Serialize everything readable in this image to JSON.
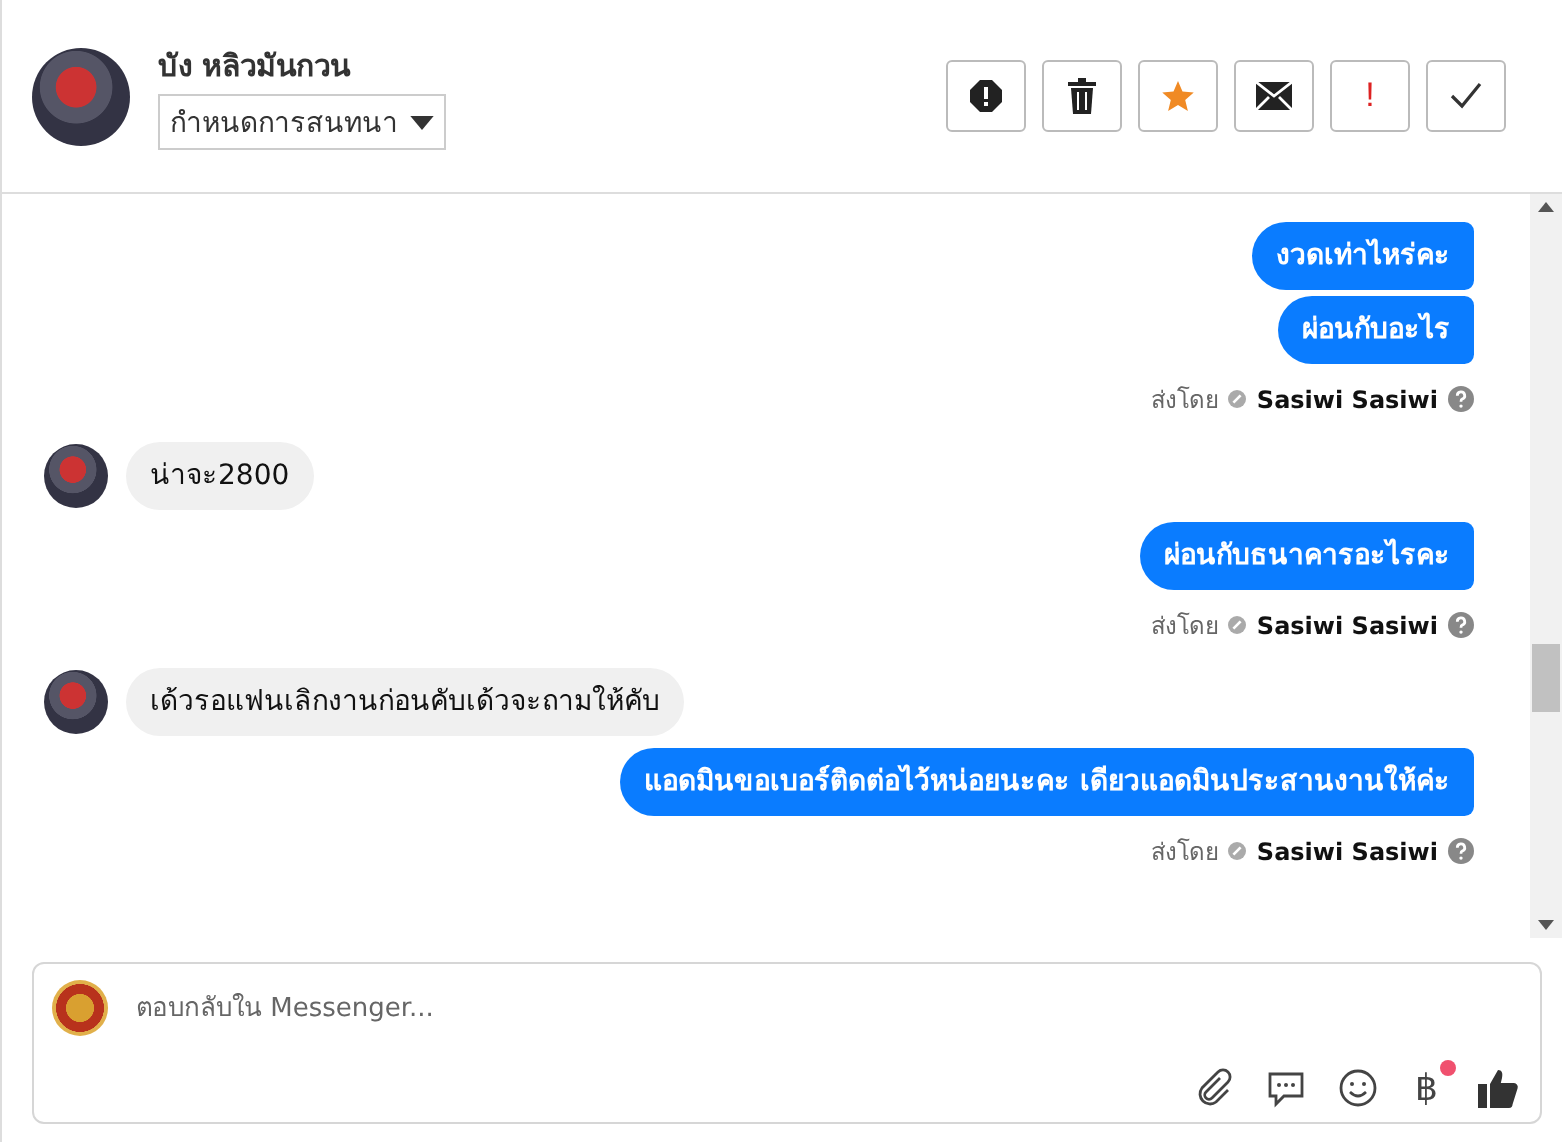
{
  "header": {
    "contact_name": "บัง หลิวมันกวน",
    "conversation_dropdown": "กำหนดการสนทนา",
    "actions": [
      {
        "kind": "report"
      },
      {
        "kind": "delete"
      },
      {
        "kind": "star"
      },
      {
        "kind": "mail"
      },
      {
        "kind": "important",
        "text": "!"
      },
      {
        "kind": "done"
      }
    ]
  },
  "messages": [
    {
      "kind": "out",
      "text": "งวดเท่าไหร่คะ"
    },
    {
      "kind": "out",
      "text": "ผ่อนกับอะไร"
    },
    {
      "kind": "sent_by",
      "label": "ส่งโดย",
      "sender": "Sasiwi Sasiwi"
    },
    {
      "kind": "in",
      "text": "น่าจะ2800"
    },
    {
      "kind": "out",
      "text": "ผ่อนกับธนาคารอะไรคะ"
    },
    {
      "kind": "sent_by",
      "label": "ส่งโดย",
      "sender": "Sasiwi Sasiwi"
    },
    {
      "kind": "in",
      "text": "เด้วรอแฟนเลิกงานก่อนคับเด้วจะถามให้คับ"
    },
    {
      "kind": "out",
      "text": "แอดมินขอเบอร์ติดต่อไว้หน่อยนะคะ เดียวแอดมินประสานงานให้ค่ะ"
    },
    {
      "kind": "sent_by",
      "label": "ส่งโดย",
      "sender": "Sasiwi Sasiwi"
    }
  ],
  "composer": {
    "placeholder": "ตอบกลับใน Messenger...",
    "tools": [
      {
        "kind": "attach"
      },
      {
        "kind": "chat"
      },
      {
        "kind": "emoji"
      },
      {
        "kind": "currency",
        "text": "฿",
        "has_notification": true
      },
      {
        "kind": "like"
      }
    ]
  }
}
